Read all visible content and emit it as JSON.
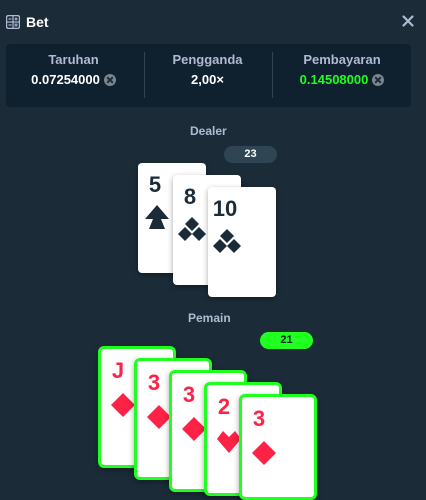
{
  "header": {
    "title": "Bet",
    "icon": "cards-icon",
    "close_icon": "close-icon"
  },
  "stats": {
    "bet": {
      "label": "Taruhan",
      "value": "0.07254000",
      "currency_icon": "coin-icon"
    },
    "multiplier": {
      "label": "Pengganda",
      "value": "2,00×"
    },
    "payout": {
      "label": "Pembayaran",
      "value": "0.14508000",
      "currency_icon": "coin-icon",
      "color": "#1fff20"
    }
  },
  "dealer": {
    "label": "Dealer",
    "score": "23",
    "cards": [
      {
        "rank": "5",
        "suit": "spades"
      },
      {
        "rank": "8",
        "suit": "clubs"
      },
      {
        "rank": "10",
        "suit": "clubs"
      }
    ]
  },
  "player": {
    "label": "Pemain",
    "score": "21",
    "cards": [
      {
        "rank": "J",
        "suit": "diamonds"
      },
      {
        "rank": "3",
        "suit": "diamonds"
      },
      {
        "rank": "3",
        "suit": "diamonds"
      },
      {
        "rank": "2",
        "suit": "hearts"
      },
      {
        "rank": "3",
        "suit": "diamonds"
      }
    ]
  },
  "colors": {
    "background": "#1b2c38",
    "panel": "#0f212e",
    "win": "#1fff20",
    "red_suit": "#fe2247",
    "black_suit": "#1b2c38"
  }
}
